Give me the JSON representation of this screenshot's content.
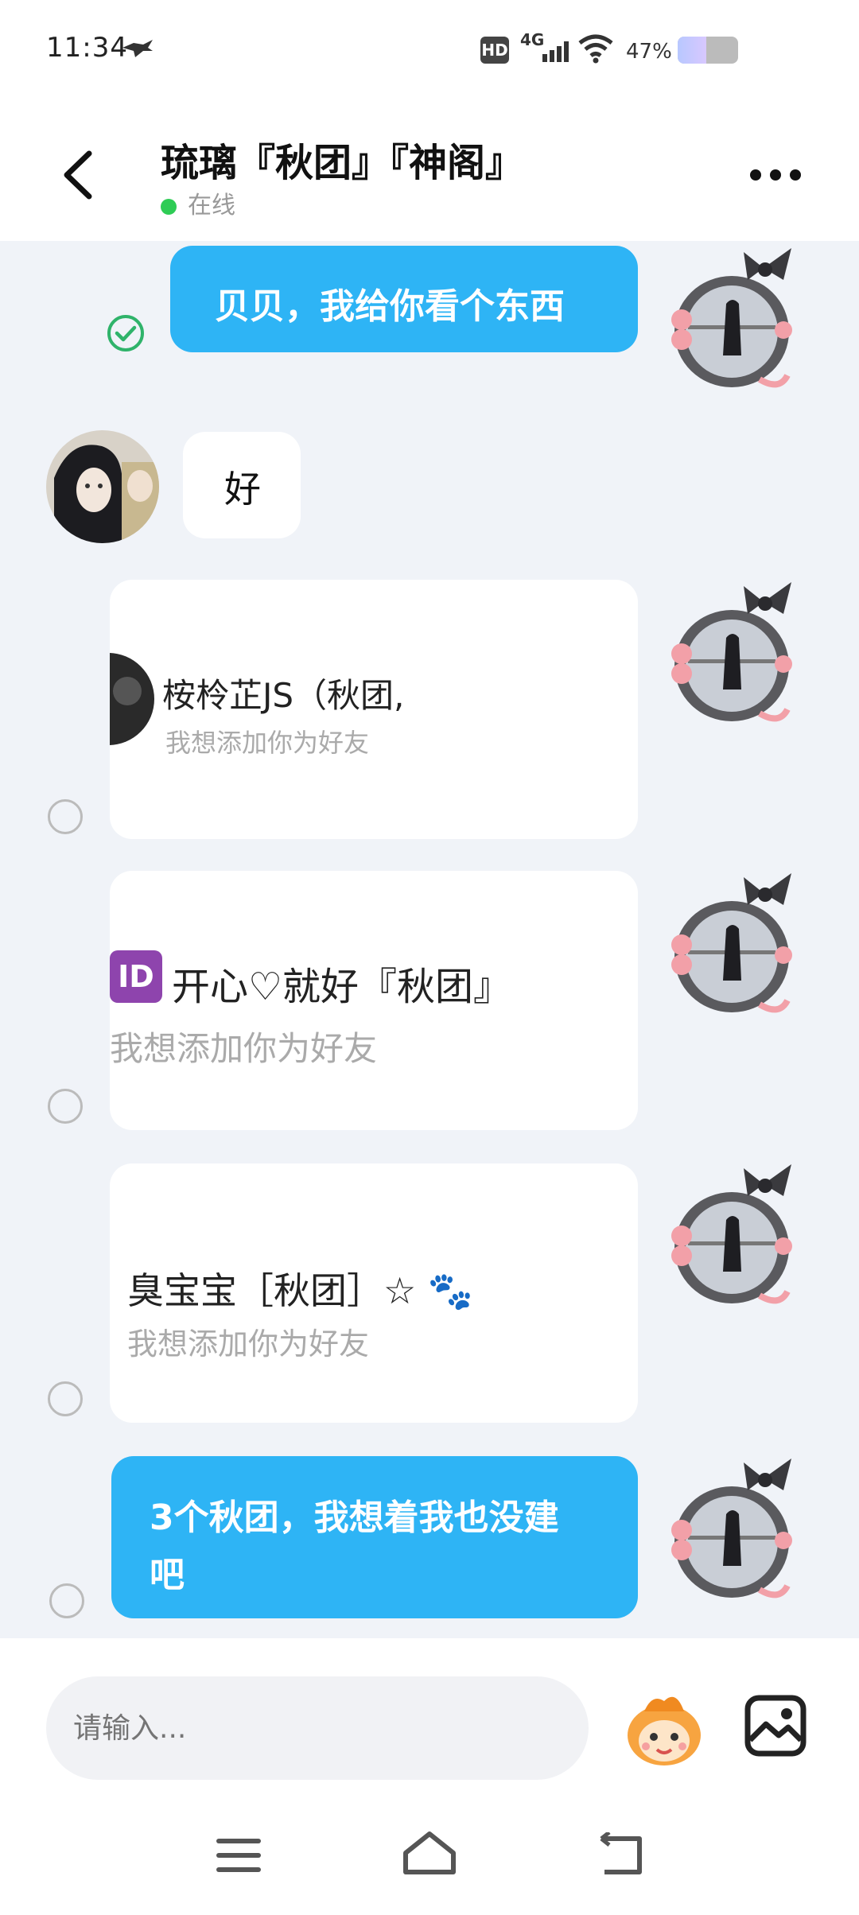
{
  "status_bar": {
    "time": "11:34",
    "battery_percent_label": "47%",
    "battery_level": 0.47,
    "icons": [
      "bird-icon",
      "hd-icon",
      "4g-signal-icon",
      "wifi-icon",
      "battery-icon"
    ],
    "hd_label": "HD",
    "network_label": "4G"
  },
  "header": {
    "title": "琉璃『秋团』『神阁』",
    "status": "在线",
    "status_color": "#2ecc55"
  },
  "messages": [
    {
      "side": "me",
      "type": "text",
      "text": "贝贝，我给你看个东西",
      "status": "sent-check"
    },
    {
      "side": "other",
      "type": "text",
      "text": "好"
    },
    {
      "side": "me",
      "type": "contact_card",
      "name": "桉柃芷JS（秋团,",
      "subtitle": "我想添加你为好友"
    },
    {
      "side": "me",
      "type": "contact_card",
      "id_badge": "ID",
      "name": "开心♡就好『秋团』",
      "subtitle": "我想添加你为好友"
    },
    {
      "side": "me",
      "type": "contact_card",
      "name": "臭宝宝［秋团］☆ 🐾",
      "subtitle": "我想添加你为好友"
    },
    {
      "side": "me",
      "type": "text",
      "text_line1": "3个秋团，我想着我也没建",
      "text_line2": "吧"
    }
  ],
  "input": {
    "placeholder": "请输入..."
  },
  "colors": {
    "bubble_blue": "#2eb4f5",
    "chat_bg": "#f0f3f8",
    "check_green": "#2fb36a"
  },
  "nav_icons": [
    "menu-icon",
    "home-icon",
    "back-icon"
  ]
}
